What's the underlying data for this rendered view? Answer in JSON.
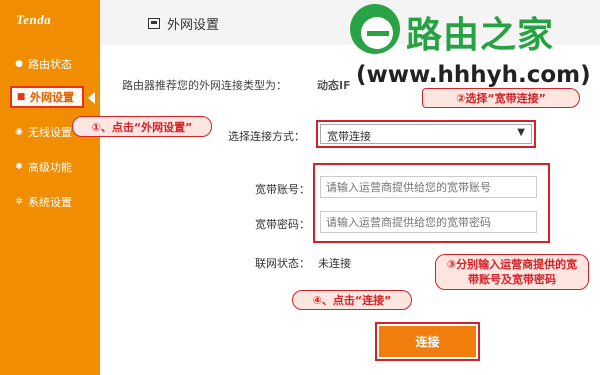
{
  "sidebar": {
    "logo": "Tenda",
    "items": [
      {
        "label": "路由状态",
        "icon": "status-icon"
      },
      {
        "label": "外网设置",
        "icon": "wan-icon",
        "active": true
      },
      {
        "label": "无线设置",
        "icon": "wireless-icon"
      },
      {
        "label": "高级功能",
        "icon": "advanced-icon"
      },
      {
        "label": "系统设置",
        "icon": "settings-icon"
      }
    ]
  },
  "header": {
    "title": "外网设置",
    "icon": "wan-settings-icon"
  },
  "brand": {
    "name": "路由之家",
    "url": "(www.hhhyh.com)",
    "color": "#27a243"
  },
  "form": {
    "detect_label": "路由器推荐您的外网连接类型为：",
    "detect_value": "动态IF",
    "mode_label": "选择连接方式：",
    "mode_value": "宽带连接",
    "account_label": "宽带账号：",
    "account_placeholder": "请输入运营商提供给您的宽带账号",
    "password_label": "宽带密码：",
    "password_placeholder": "请输入运营商提供给您的宽带密码",
    "status_label": "联网状态：",
    "status_value": "未连接",
    "connect_button": "连接"
  },
  "annotations": {
    "step1": "①、点击“外网设置”",
    "step2": "②选择“宽带连接”",
    "step3": "③分别输入运营商提供的宽带账号及宽带密码",
    "step4": "④、点击“连接”"
  },
  "colors": {
    "accent": "#f18d00",
    "annotation": "#d2232a",
    "button": "#f07d0c"
  }
}
